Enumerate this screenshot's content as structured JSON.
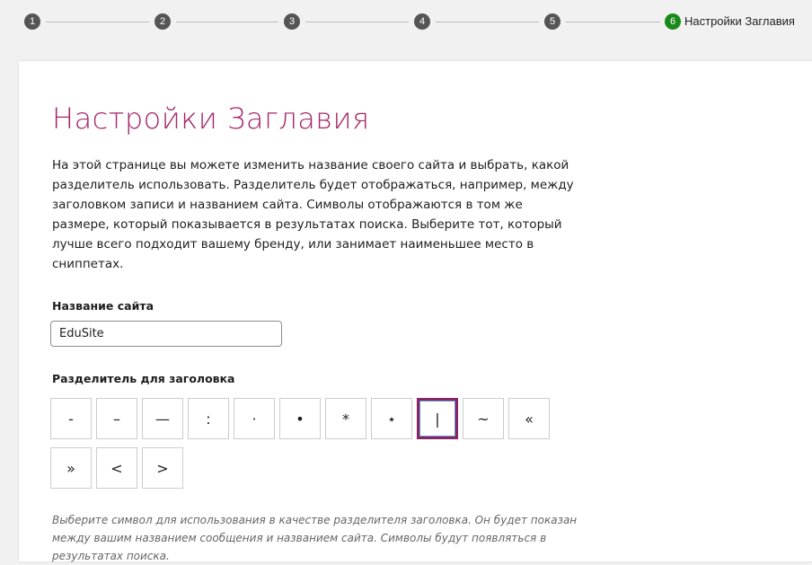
{
  "stepper": {
    "steps": [
      "1",
      "2",
      "3",
      "4",
      "5",
      "6"
    ],
    "active_label": "Настройки Заглавия",
    "active_color": "#1a8a1a"
  },
  "page": {
    "title": "Настройки Заглавия",
    "description": "На этой странице вы можете изменить название своего сайта и выбрать, какой разделитель использовать. Разделитель будет отображаться, например, между заголовком записи и названием сайта. Символы отображаются в том же размере, который показывается в результатах поиска. Выберите тот, который лучше всего подходит вашему бренду, или занимает наименьшее место в сниппетах.",
    "title_color": "#a4286a"
  },
  "site_name": {
    "label": "Название сайта",
    "value": "EduSite"
  },
  "separator": {
    "label": "Разделитель для заголовка",
    "options": [
      "-",
      "–",
      "—",
      ":",
      "·",
      "•",
      "*",
      "⋆",
      "|",
      "~",
      "«",
      "»",
      "<",
      ">"
    ],
    "selected": "|",
    "help": "Выберите символ для использования в качестве разделителя заголовка. Он будет показан между вашим названием сообщения и названием сайта. Символы будут появляться в результатах поиска."
  }
}
